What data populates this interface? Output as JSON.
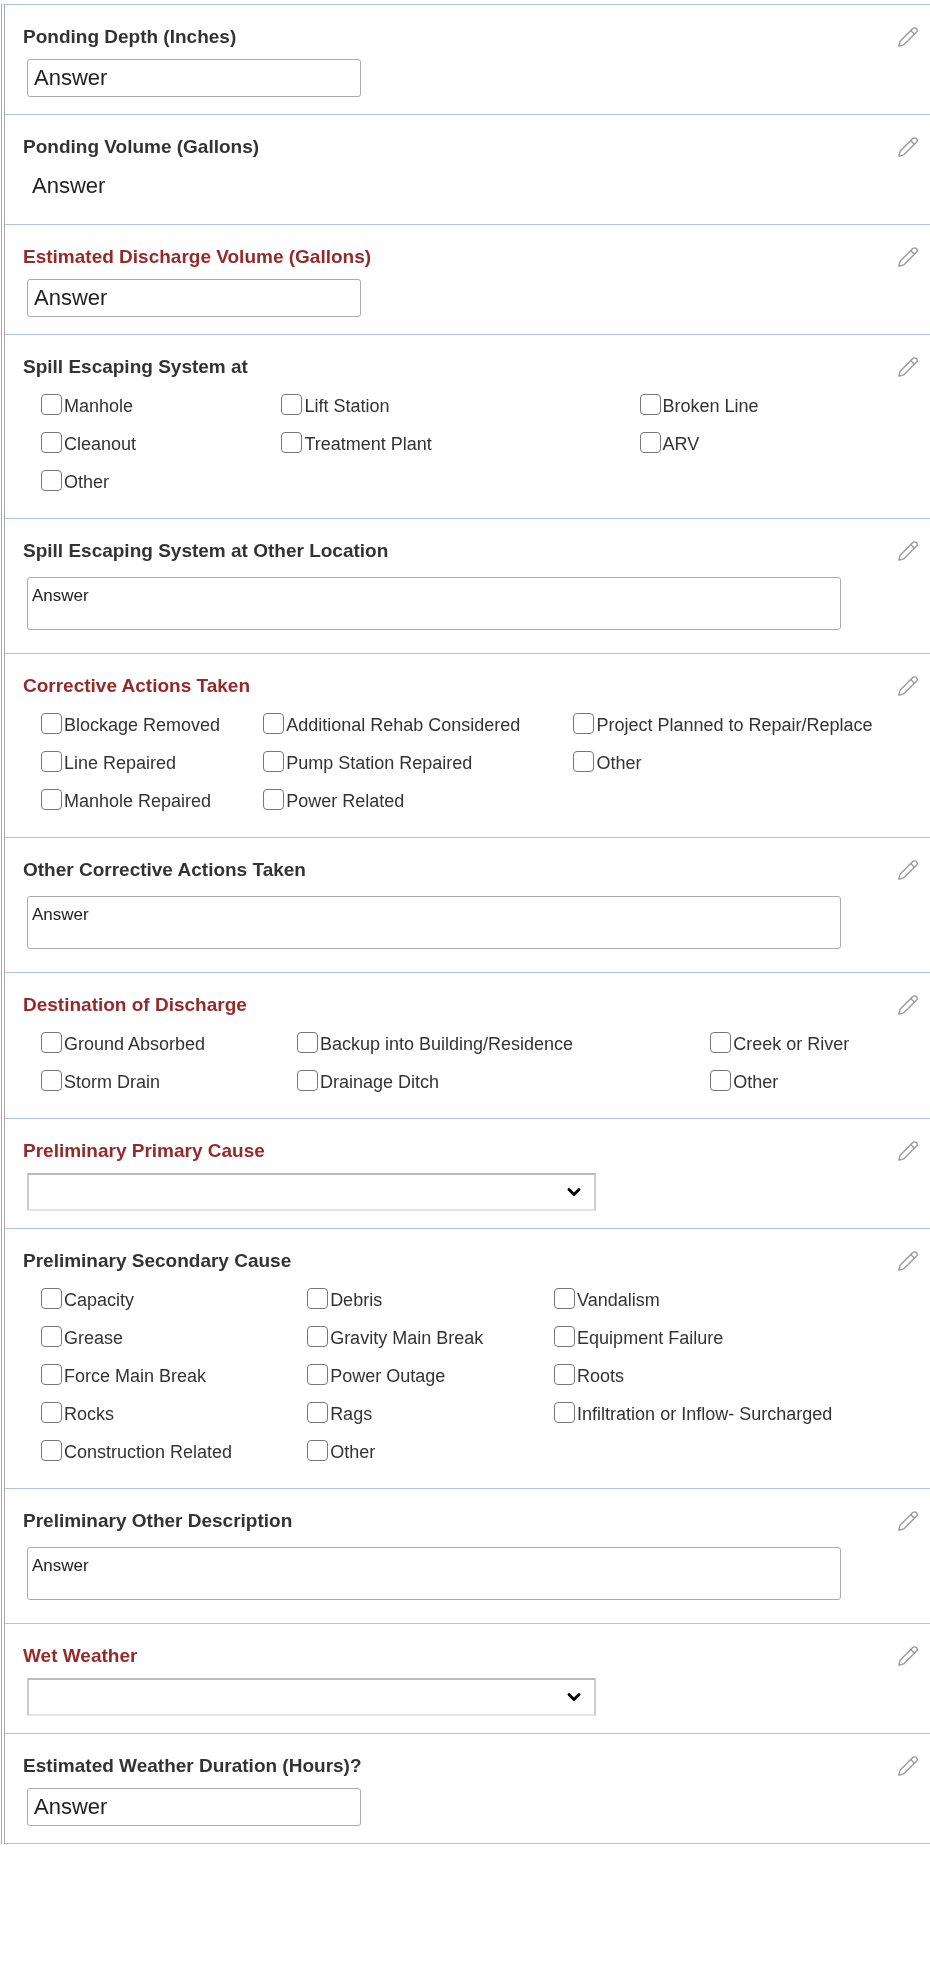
{
  "sections": [
    {
      "title": "Ponding Depth (Inches)",
      "required": false,
      "kind": "input",
      "value": "Answer"
    },
    {
      "title": "Ponding Volume (Gallons)",
      "required": false,
      "kind": "text",
      "value": "Answer"
    },
    {
      "title": "Estimated Discharge Volume (Gallons)",
      "required": true,
      "kind": "input",
      "value": "Answer"
    },
    {
      "title": "Spill Escaping System at",
      "required": false,
      "kind": "checkboxes",
      "rows": [
        [
          {
            "label": "Manhole",
            "checked": false
          },
          {
            "label": "Lift Station",
            "checked": false
          },
          {
            "label": "Broken Line",
            "checked": false
          }
        ],
        [
          {
            "label": "Cleanout",
            "checked": false
          },
          {
            "label": "Treatment Plant",
            "checked": false
          },
          {
            "label": "ARV",
            "checked": false
          }
        ],
        [
          {
            "label": "Other",
            "checked": false
          }
        ]
      ]
    },
    {
      "title": "Spill Escaping System at Other Location",
      "required": false,
      "kind": "textarea",
      "value": "Answer"
    },
    {
      "title": "Corrective Actions Taken",
      "required": true,
      "kind": "checkboxes",
      "rows": [
        [
          {
            "label": "Blockage Removed",
            "checked": false
          },
          {
            "label": "Additional Rehab Considered",
            "checked": false
          },
          {
            "label": "Project Planned to Repair/Replace",
            "checked": false
          }
        ],
        [
          {
            "label": "Line Repaired",
            "checked": false
          },
          {
            "label": "Pump Station Repaired",
            "checked": false
          },
          {
            "label": "Other",
            "checked": false
          }
        ],
        [
          {
            "label": "Manhole Repaired",
            "checked": false
          },
          {
            "label": "Power Related",
            "checked": false
          }
        ]
      ]
    },
    {
      "title": "Other Corrective Actions Taken",
      "required": false,
      "kind": "textarea",
      "value": "Answer"
    },
    {
      "title": "Destination of Discharge",
      "required": true,
      "kind": "checkboxes",
      "rows": [
        [
          {
            "label": "Ground Absorbed",
            "checked": false
          },
          {
            "label": "Backup into Building/Residence",
            "checked": false
          },
          {
            "label": "Creek or River",
            "checked": false
          }
        ],
        [
          {
            "label": "Storm Drain",
            "checked": false
          },
          {
            "label": "Drainage Ditch",
            "checked": false
          },
          {
            "label": "Other",
            "checked": false
          }
        ]
      ]
    },
    {
      "title": "Preliminary Primary Cause",
      "required": true,
      "kind": "select"
    },
    {
      "title": "Preliminary Secondary Cause",
      "required": false,
      "kind": "checkboxes",
      "rows": [
        [
          {
            "label": "Capacity",
            "checked": false
          },
          {
            "label": "Debris",
            "checked": false
          },
          {
            "label": "Vandalism",
            "checked": false
          }
        ],
        [
          {
            "label": "Grease",
            "checked": false
          },
          {
            "label": "Gravity Main Break",
            "checked": false
          },
          {
            "label": "Equipment Failure",
            "checked": false
          }
        ],
        [
          {
            "label": "Force Main Break",
            "checked": false
          },
          {
            "label": "Power Outage",
            "checked": false
          },
          {
            "label": "Roots",
            "checked": false
          }
        ],
        [
          {
            "label": "Rocks",
            "checked": false
          },
          {
            "label": "Rags",
            "checked": false
          },
          {
            "label": "Infiltration or Inflow- Surcharged",
            "checked": false
          }
        ],
        [
          {
            "label": "Construction Related",
            "checked": false
          },
          {
            "label": "Other",
            "checked": false
          }
        ]
      ]
    },
    {
      "title": "Preliminary Other Description",
      "required": false,
      "kind": "textarea",
      "value": "Answer"
    },
    {
      "title": "Wet Weather",
      "required": true,
      "kind": "select"
    },
    {
      "title": "Estimated Weather Duration (Hours)?",
      "required": false,
      "kind": "input",
      "value": "Answer"
    }
  ]
}
